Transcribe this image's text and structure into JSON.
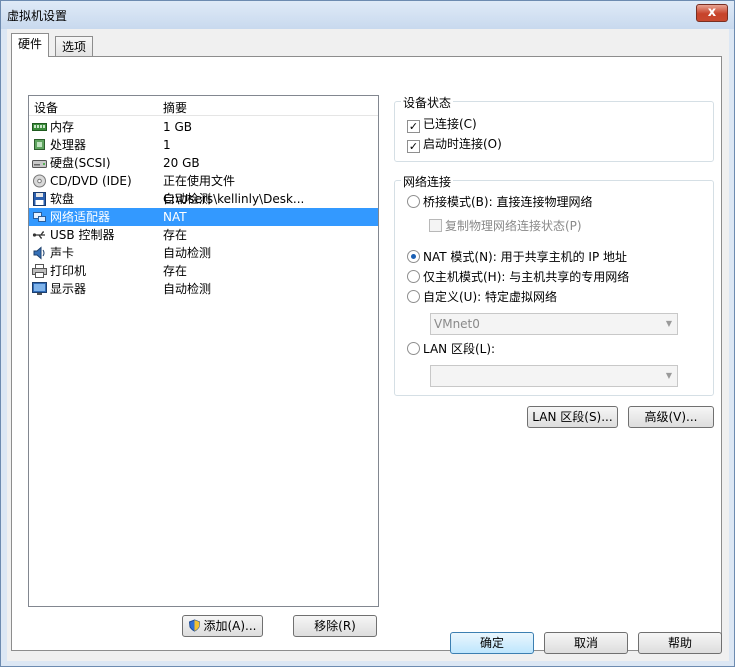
{
  "window": {
    "title": "虚拟机设置",
    "close_label": "x"
  },
  "tabs": [
    {
      "label": "硬件"
    },
    {
      "label": "选项"
    }
  ],
  "device_list": {
    "header": {
      "device": "设备",
      "summary": "摘要"
    },
    "rows": [
      {
        "name": "内存",
        "summary": "1 GB",
        "icon": "memory-icon"
      },
      {
        "name": "处理器",
        "summary": "1",
        "icon": "processor-icon"
      },
      {
        "name": "硬盘(SCSI)",
        "summary": "20 GB",
        "icon": "harddisk-icon"
      },
      {
        "name": "CD/DVD (IDE)",
        "summary": "正在使用文件 C:\\Users\\kellinly\\Desk...",
        "icon": "cdrom-icon"
      },
      {
        "name": "软盘",
        "summary": "自动检测",
        "icon": "floppy-icon"
      },
      {
        "name": "网络适配器",
        "summary": "NAT",
        "icon": "network-adapter-icon"
      },
      {
        "name": "USB 控制器",
        "summary": "存在",
        "icon": "usb-icon"
      },
      {
        "name": "声卡",
        "summary": "自动检测",
        "icon": "sound-icon"
      },
      {
        "name": "打印机",
        "summary": "存在",
        "icon": "printer-icon"
      },
      {
        "name": "显示器",
        "summary": "自动检测",
        "icon": "display-icon"
      }
    ],
    "selected_index": 5
  },
  "list_buttons": {
    "add": "添加(A)...",
    "remove": "移除(R)"
  },
  "device_status": {
    "title": "设备状态",
    "connected": "已连接(C)",
    "connect_at_power_on": "启动时连接(O)"
  },
  "network_connection": {
    "title": "网络连接",
    "bridged": "桥接模式(B): 直接连接物理网络",
    "replicate": "复制物理网络连接状态(P)",
    "nat": "NAT 模式(N): 用于共享主机的 IP 地址",
    "host_only": "仅主机模式(H): 与主机共享的专用网络",
    "custom": "自定义(U): 特定虚拟网络",
    "custom_value": "VMnet0",
    "lan_segment": "LAN 区段(L):",
    "lan_segment_value": ""
  },
  "network_buttons": {
    "lan_segments": "LAN 区段(S)...",
    "advanced": "高级(V)..."
  },
  "dialog_buttons": {
    "ok": "确定",
    "cancel": "取消",
    "help": "帮助"
  },
  "colors": {
    "selection": "#3399ff",
    "radio_dot": "#1a5fb4",
    "close_button": "#c7432a"
  }
}
